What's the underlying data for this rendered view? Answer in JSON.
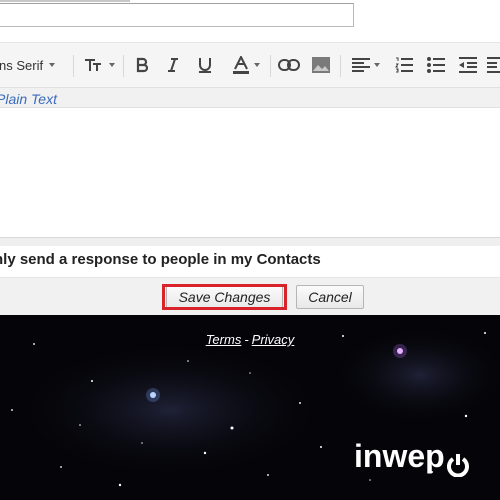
{
  "toolbar": {
    "font_name": "ns Serif",
    "icons": [
      "font-size-icon",
      "bold-icon",
      "italic-icon",
      "underline-icon",
      "text-color-icon",
      "link-icon",
      "image-icon",
      "align-icon",
      "numbered-list-icon",
      "bulleted-list-icon",
      "indent-less-icon",
      "indent-more-icon"
    ]
  },
  "compose": {
    "plain_text_link": "Plain Text",
    "contacts_option": "nly send a response to people in my Contacts"
  },
  "actions": {
    "save_label": "Save Changes",
    "cancel_label": "Cancel"
  },
  "footer": {
    "terms": "Terms",
    "separator": "-",
    "privacy": "Privacy",
    "watermark": "inwepo"
  },
  "colors": {
    "highlight": "#d8232a",
    "link_blue": "#3b6bbd",
    "footer_bg": "#020204"
  }
}
